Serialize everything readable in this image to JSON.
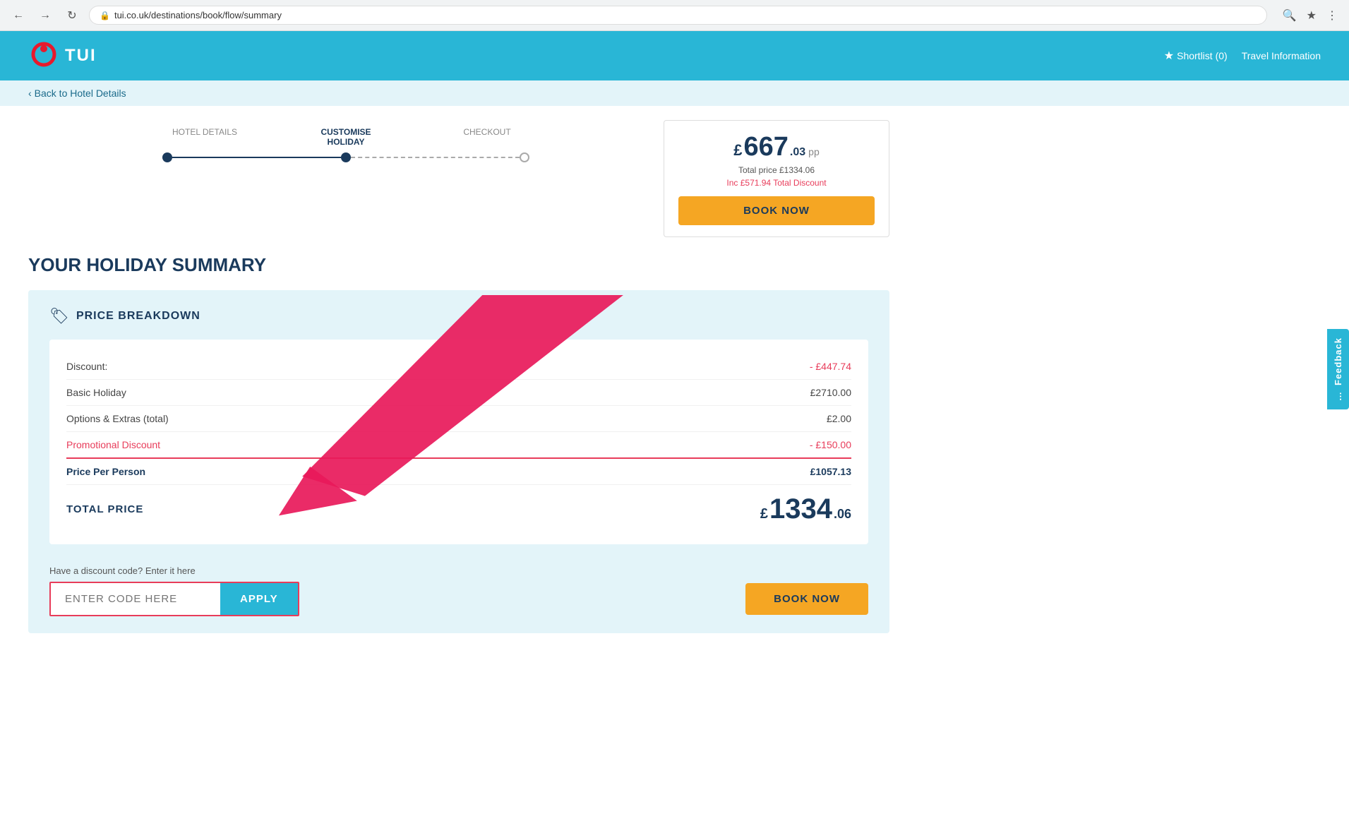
{
  "browser": {
    "url": "tui.co.uk/destinations/book/flow/summary",
    "back_tooltip": "Back",
    "forward_tooltip": "Forward",
    "reload_tooltip": "Reload"
  },
  "header": {
    "logo_text": "TUI",
    "shortlist_label": "Shortlist (0)",
    "travel_info_label": "Travel Information"
  },
  "sub_nav": {
    "back_label": "Back to Hotel Details"
  },
  "progress": {
    "steps": [
      {
        "label": "HOTEL DETAILS",
        "state": "completed"
      },
      {
        "label": "CUSTOMISE HOLIDAY",
        "state": "active"
      },
      {
        "label": "CHECKOUT",
        "state": "upcoming"
      }
    ]
  },
  "booking_widget": {
    "price_currency": "£",
    "price_main": "667",
    "price_decimal": ".03",
    "price_pp": "pp",
    "total_price_label": "Total price £1334.06",
    "discount_text": "Inc £571.94 Total Discount",
    "book_now_label": "BOOK NOW"
  },
  "page_title": "YOUR HOLIDAY SUMMARY",
  "price_breakdown": {
    "section_title": "PRICE BREAKDOWN",
    "rows": [
      {
        "label": "Discount:",
        "value": "- £447.74",
        "type": "discount"
      },
      {
        "label": "Basic Holiday",
        "value": "£2710.00",
        "type": "normal"
      },
      {
        "label": "Options & Extras (total)",
        "value": "£2.00",
        "type": "normal"
      },
      {
        "label": "Promotional Discount",
        "value": "- £150.00",
        "type": "promo"
      }
    ],
    "per_person_label": "Price Per Person",
    "per_person_value": "£1057.13",
    "total_label": "TOTAL PRICE",
    "total_currency": "£",
    "total_main": "1334",
    "total_decimal": ".06"
  },
  "discount_code": {
    "label": "Have a discount code? Enter it here",
    "placeholder": "ENTER CODE HERE",
    "apply_label": "APPLY"
  },
  "bottom_book_now": "BOOK NOW",
  "feedback": {
    "label": "Feedback"
  }
}
